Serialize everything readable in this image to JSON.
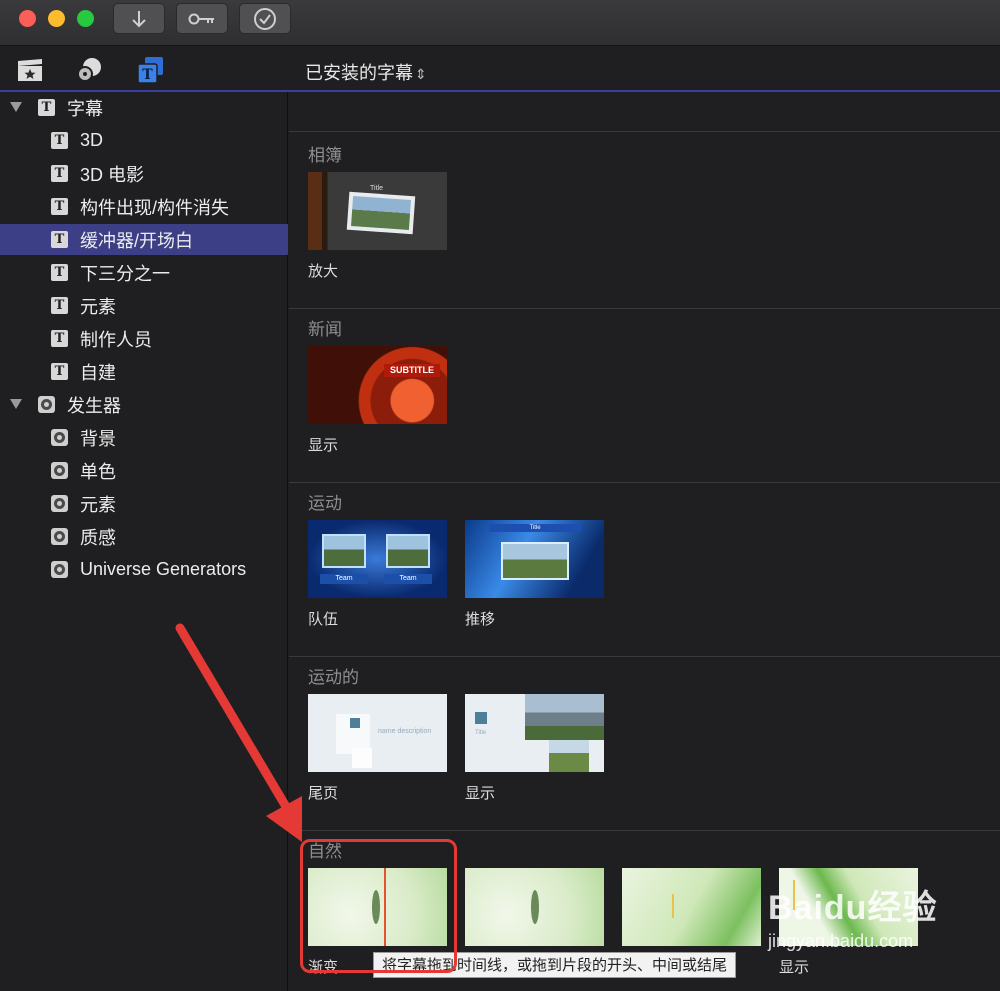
{
  "header": {
    "title": "已安装的字幕"
  },
  "sidebar": {
    "groups": [
      {
        "label": "字幕",
        "items": [
          "3D",
          "3D 电影",
          "构件出现/构件消失",
          "缓冲器/开场白",
          "下三分之一",
          "元素",
          "制作人员",
          "自建"
        ]
      },
      {
        "label": "发生器",
        "items": [
          "背景",
          "单色",
          "元素",
          "质感",
          "Universe Generators"
        ]
      }
    ],
    "selected": "缓冲器/开场白"
  },
  "sections": [
    {
      "title": "相簿",
      "items": [
        {
          "caption": "放大",
          "thumb_text": "Title"
        }
      ]
    },
    {
      "title": "新闻",
      "items": [
        {
          "caption": "显示",
          "thumb_text": "SUBTITLE"
        }
      ]
    },
    {
      "title": "运动",
      "items": [
        {
          "caption": "队伍",
          "thumb_text": "Team"
        },
        {
          "caption": "推移",
          "thumb_text": "Title"
        }
      ]
    },
    {
      "title": "运动的",
      "items": [
        {
          "caption": "尾页",
          "thumb_text": "name description"
        },
        {
          "caption": "显示",
          "thumb_text": "Title"
        }
      ]
    },
    {
      "title": "自然",
      "items": [
        {
          "caption": "渐变"
        },
        {
          "caption": ""
        },
        {
          "caption": ""
        },
        {
          "caption": "显示"
        }
      ]
    }
  ],
  "tooltip": "将字幕拖到时间线，或拖到片段的开头、中间或结尾",
  "watermark": {
    "logo": "Baidu经验",
    "url": "jingyan.baidu.com"
  }
}
